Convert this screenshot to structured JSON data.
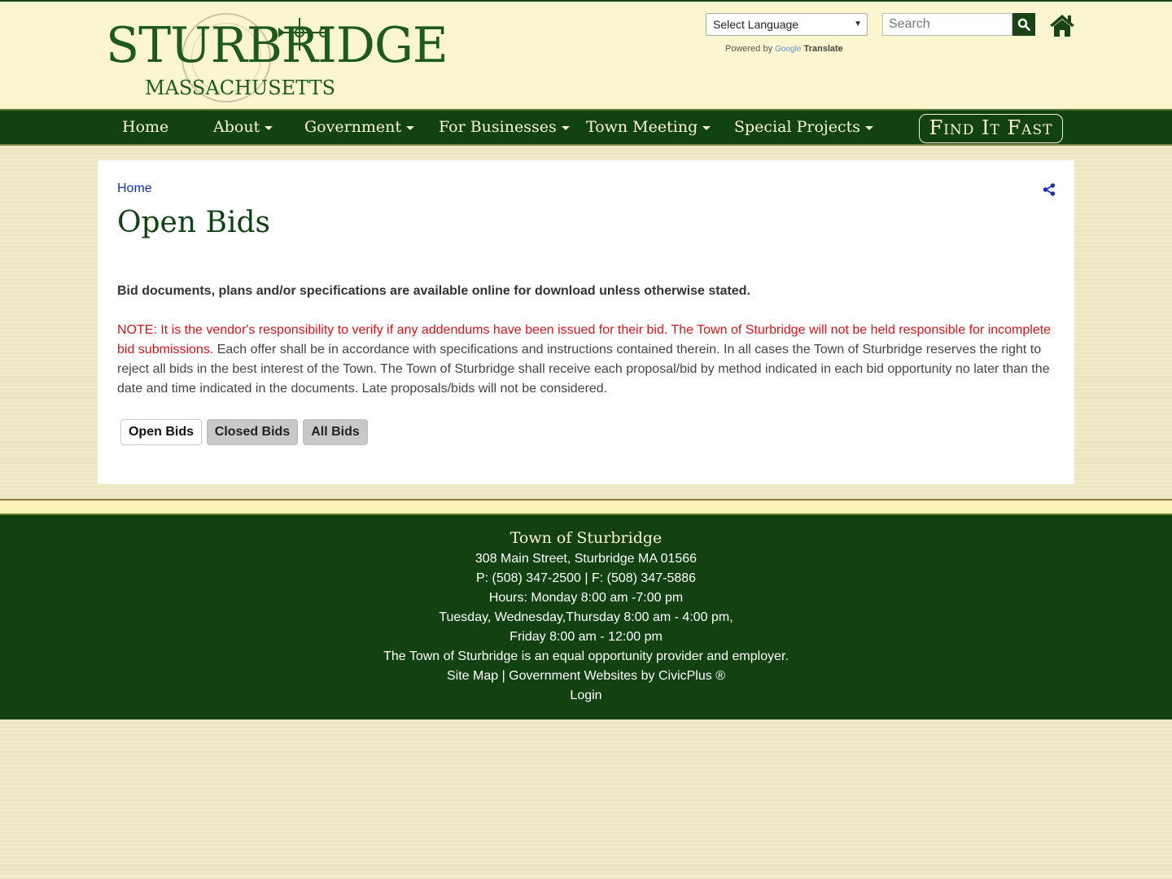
{
  "header": {
    "logo_title": "STURBRIDGE",
    "logo_subtitle": "MASSACHUSETTS",
    "language_select": "Select Language",
    "powered_by": "Powered by",
    "google": "Google",
    "translate": "Translate",
    "search_placeholder": "Search"
  },
  "nav": {
    "items": [
      {
        "label": "Home"
      },
      {
        "label": "About"
      },
      {
        "label": "Government"
      },
      {
        "label": "For Businesses"
      },
      {
        "label": "Town Meeting"
      },
      {
        "label": "Special Projects"
      }
    ],
    "find_it_fast": "Find It Fast"
  },
  "main": {
    "breadcrumb": "Home",
    "title": "Open Bids",
    "lead": "Bid documents, plans and/or specifications are available online for download unless otherwise stated.",
    "note_red": "NOTE: It is the vendor's responsibility to verify if any addendums have been issued for their bid.  The Town of Sturbridge will not be held responsible for incomplete bid submissions.",
    "note_rest": " Each offer shall be in accordance with specifications and instructions contained therein. In all cases the Town of Sturbridge reserves the right to reject all bids in the best interest of the Town.  The Town of Sturbridge shall receive each proposal/bid by method indicated in each bid opportunity no later than the date and time indicated in the documents. Late proposals/bids will not be considered.",
    "tabs": [
      {
        "label": "Open Bids"
      },
      {
        "label": "Closed Bids"
      },
      {
        "label": "All Bids"
      }
    ]
  },
  "footer": {
    "title": "Town of Sturbridge",
    "address": "308 Main Street, Sturbridge MA 01566",
    "phone": "P: (508) 347-2500 | F: (508) 347-5886",
    "hours1": "Hours: Monday 8:00 am -7:00 pm",
    "hours2": "Tuesday, Wednesday,Thursday 8:00 am - 4:00 pm,",
    "hours3": "Friday 8:00 am - 12:00 pm",
    "equal": "The Town of Sturbridge is an equal opportunity provider and employer.",
    "site_map": "Site Map",
    "sep": " | ",
    "civicplus": "Government Websites by CivicPlus ®",
    "login": "Login"
  },
  "colors": {
    "brand_green": "#124212",
    "header_bg": "#fbf6cf",
    "note_red": "#d0161b",
    "link_blue": "#1a2fb0"
  },
  "icons": [
    "search-icon",
    "home-icon",
    "share-icon",
    "chevron-down-icon",
    "town-seal-logo"
  ]
}
